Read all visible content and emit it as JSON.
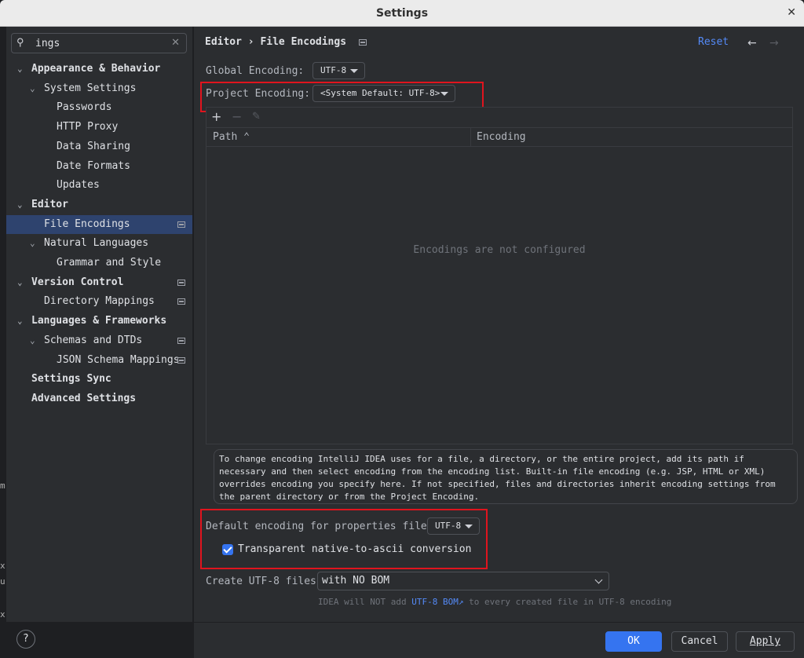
{
  "window": {
    "title": "Settings",
    "close_glyph": "✕"
  },
  "left_edge_fragments": [
    "m",
    "x",
    "u",
    "x"
  ],
  "sidebar": {
    "search": {
      "value": "ings",
      "clear_glyph": "✕"
    },
    "items": [
      {
        "label": "Appearance & Behavior",
        "level": 0,
        "expanded": true,
        "bold": true
      },
      {
        "label": "System Settings",
        "level": 1,
        "expanded": true
      },
      {
        "label": "Passwords",
        "level": 2
      },
      {
        "label": "HTTP Proxy",
        "level": 2
      },
      {
        "label": "Data Sharing",
        "level": 2
      },
      {
        "label": "Date Formats",
        "level": 2
      },
      {
        "label": "Updates",
        "level": 2
      },
      {
        "label": "Editor",
        "level": 0,
        "expanded": true,
        "bold": true
      },
      {
        "label": "File Encodings",
        "level": 1,
        "selected": true,
        "project_icon": true
      },
      {
        "label": "Natural Languages",
        "level": 1,
        "expanded": true
      },
      {
        "label": "Grammar and Style",
        "level": 2
      },
      {
        "label": "Version Control",
        "level": 0,
        "expanded": true,
        "bold": true,
        "project_icon": true
      },
      {
        "label": "Directory Mappings",
        "level": 1,
        "project_icon": true
      },
      {
        "label": "Languages & Frameworks",
        "level": 0,
        "expanded": true,
        "bold": true
      },
      {
        "label": "Schemas and DTDs",
        "level": 1,
        "expanded": true,
        "project_icon": true
      },
      {
        "label": "JSON Schema Mappings",
        "level": 2,
        "project_icon": true
      },
      {
        "label": "Settings Sync",
        "level": 0,
        "bold": true
      },
      {
        "label": "Advanced Settings",
        "level": 0,
        "bold": true
      }
    ],
    "help_label": "?"
  },
  "header": {
    "breadcrumb_parent": "Editor",
    "breadcrumb_separator": "›",
    "breadcrumb_current": "File Encodings",
    "reset_label": "Reset",
    "back_glyph": "←",
    "forward_glyph": "→"
  },
  "encodings": {
    "global_label": "Global Encoding:",
    "global_value": "UTF-8",
    "project_label": "Project Encoding:",
    "project_value": "<System Default: UTF-8>",
    "toolbar": {
      "add": "+",
      "remove": "−",
      "edit": "✎"
    },
    "columns": {
      "path": "Path ⌃",
      "encoding": "Encoding"
    },
    "empty_text": "Encodings are not configured",
    "note": "To change encoding IntelliJ IDEA uses for a file, a directory, or the entire project, add its path if necessary and then select encoding from the encoding list. Built-in file encoding (e.g. JSP, HTML or XML) overrides encoding you specify here. If not specified, files and directories inherit encoding settings from the parent directory or from the Project Encoding.",
    "properties_label": "Default encoding for properties files:",
    "properties_value": "UTF-8",
    "native_to_ascii_label": "Transparent native-to-ascii conversion",
    "native_to_ascii_checked": true,
    "create_utf8_label": "Create UTF-8 files:",
    "create_utf8_value": "with NO BOM",
    "hint_before": "IDEA will NOT add",
    "hint_link": "UTF-8 BOM↗",
    "hint_after": "to every created file in UTF-8 encoding"
  },
  "footer": {
    "ok_label": "OK",
    "cancel_label": "Cancel",
    "apply_label": "Apply"
  },
  "colors": {
    "accent": "#3574f0",
    "link": "#548af7",
    "highlight_box": "#e0141e",
    "selection": "#2e436e"
  }
}
